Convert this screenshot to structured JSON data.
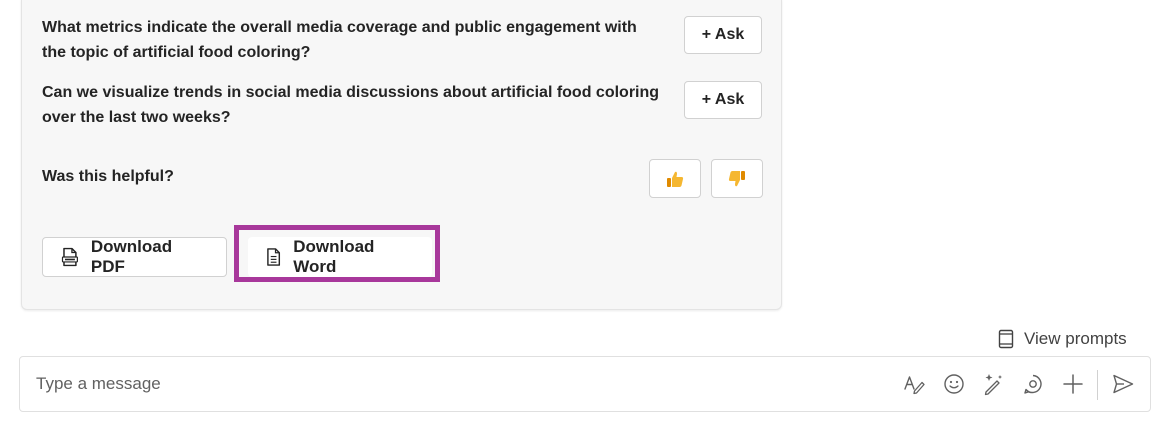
{
  "card": {
    "questions": [
      {
        "text": "What metrics indicate the overall media coverage and public engagement with the topic of artificial food coloring?",
        "ask_label": "+ Ask"
      },
      {
        "text": "Can we visualize trends in social media discussions about artificial food coloring over the last two weeks?",
        "ask_label": "+ Ask"
      }
    ],
    "helpful_prompt": "Was this helpful?",
    "thumbs_up_icon": "thumbs-up-icon",
    "thumbs_down_icon": "thumbs-down-icon",
    "download_pdf_label": "Download PDF",
    "download_word_label": "Download Word"
  },
  "view_prompts_label": "View prompts",
  "composer": {
    "placeholder": "Type a message",
    "tools": [
      "format-icon",
      "emoji-icon",
      "copilot-icon",
      "loop-icon",
      "add-icon",
      "send-icon"
    ]
  },
  "colors": {
    "highlight": "#a8389b",
    "thumb": "#f5a623",
    "card_bg": "#f7f7f7"
  }
}
